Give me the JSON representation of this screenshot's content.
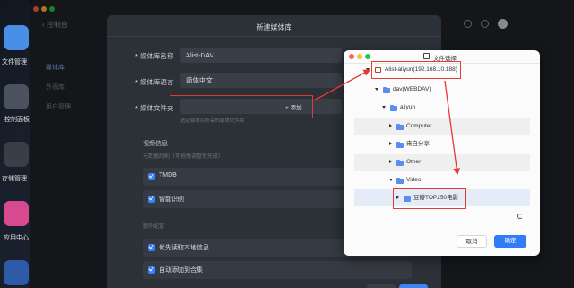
{
  "dock": {
    "items": [
      {
        "label": "文件管理",
        "color": "#4a8fe7"
      },
      {
        "label": "控制面板",
        "color": "#4a5260"
      },
      {
        "label": "存储管理",
        "color": "#3a3f47"
      },
      {
        "label": "应用中心",
        "color": "#d84a8f"
      },
      {
        "label": "",
        "color": "#2e5aa8"
      }
    ]
  },
  "app": {
    "back_label": "控制台",
    "sidebar": [
      "媒体库",
      "外观库",
      "用户管理"
    ]
  },
  "dialog": {
    "title": "新建媒体库",
    "name_label": "媒体库名称",
    "name_value": "Alist-DAV",
    "lang_label": "媒体库语言",
    "lang_value": "简体中文",
    "folder_label": "媒体文件夹",
    "add_label": "+ 添加",
    "folder_hint": "选定媒体库所需的媒体文件夹",
    "info_title": "视频信息",
    "info_sub": "元数据刮削（可拖拽调整优先级）",
    "opt_tmdb": "TMDB",
    "opt_smart": "智能识别",
    "extra_title": "额外配置",
    "opt_local": "优先读取本地信息",
    "opt_collection": "自动添加到合集"
  },
  "chooser": {
    "title": "文件选择",
    "tree": {
      "root": "Alist-aliyun(192.168.10.188)",
      "dav": "dav(WEBDAV)",
      "aliyun": "aliyun",
      "computer": "Computer",
      "shared": "来自分享",
      "other": "Other",
      "video": "Video",
      "selected": "豆瓣TOP250电影"
    },
    "cancel_label": "取消",
    "ok_label": "确定"
  },
  "colors": {
    "accent": "#3b82f6",
    "annotation_red": "#e53935"
  }
}
